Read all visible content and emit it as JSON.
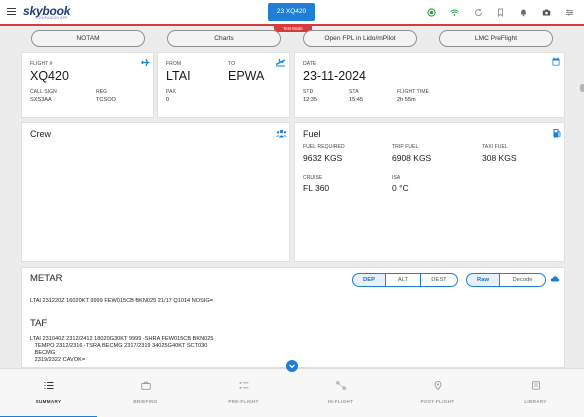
{
  "header": {
    "logo": "skybook",
    "logo_sub": "COMPANION APP",
    "flight_button": "23 XQ420",
    "mode_tag": "Test Mode",
    "icons": [
      "status-ok-icon",
      "wifi-icon",
      "sync-icon",
      "bookmark-icon",
      "bell-icon",
      "camera-icon",
      "settings-icon"
    ]
  },
  "tools": {
    "notam": "NOTAM",
    "charts": "Charts",
    "open_fpl": "Open FPL in Lido/mPilot",
    "lmc": "LMC PreFlight"
  },
  "flight": {
    "label": "FLIGHT #",
    "number": "XQ420",
    "callsign_label": "CALL SIGN",
    "callsign": "SXS3AA",
    "reg_label": "REG",
    "reg": "TCSOO"
  },
  "route": {
    "from_label": "FROM",
    "from": "LTAI",
    "to_label": "TO",
    "to": "EPWA",
    "pax_label": "PAX",
    "pax": "0"
  },
  "date": {
    "label": "DATE",
    "value": "23-11-2024",
    "std_label": "STD",
    "std": "12:35",
    "sta_label": "STA",
    "sta": "15:45",
    "ft_label": "FLIGHT TIME",
    "ft": "2h 55m"
  },
  "crew": {
    "title": "Crew"
  },
  "fuel": {
    "title": "Fuel",
    "required_label": "FUEL REQUIRED",
    "required": "9632 KGS",
    "trip_label": "TRIP FUEL",
    "trip": "6908 KGS",
    "taxi_label": "TAXI FUEL",
    "taxi": "308 KGS",
    "cruise_label": "CRUISE",
    "cruise": "FL 360",
    "isa_label": "ISA",
    "isa": "0 °C"
  },
  "metar": {
    "title": "METAR",
    "tabs": {
      "dep": "DEP",
      "alt": "ALT",
      "dest": "DEST"
    },
    "modes": {
      "raw": "Raw",
      "decode": "Decode"
    },
    "text": "LTAI 231220Z 16020KT 9999 FEW015CB BKN025 21/17 Q1014 NOSIG="
  },
  "taf": {
    "title": "TAF",
    "text": "LTAI 231040Z 2312/2412 18020G30KT 9999 -SHRA FEW015CB BKN025\n   TEMPO 2312/2316 -TSRA BECMG 2317/2319 34025G40KT SCT030\n   BECMG\n   2319/2322 CAVOK="
  },
  "nav": {
    "summary": "SUMMARY",
    "briefing": "BRIEFING",
    "preflight": "PRE-FLIGHT",
    "inflight": "IN-FLIGHT",
    "postflight": "POST-FLIGHT",
    "library": "LIBRARY"
  },
  "colors": {
    "accent": "#1e7fd4",
    "alert": "#d63a3a",
    "ok": "#2ea043"
  }
}
